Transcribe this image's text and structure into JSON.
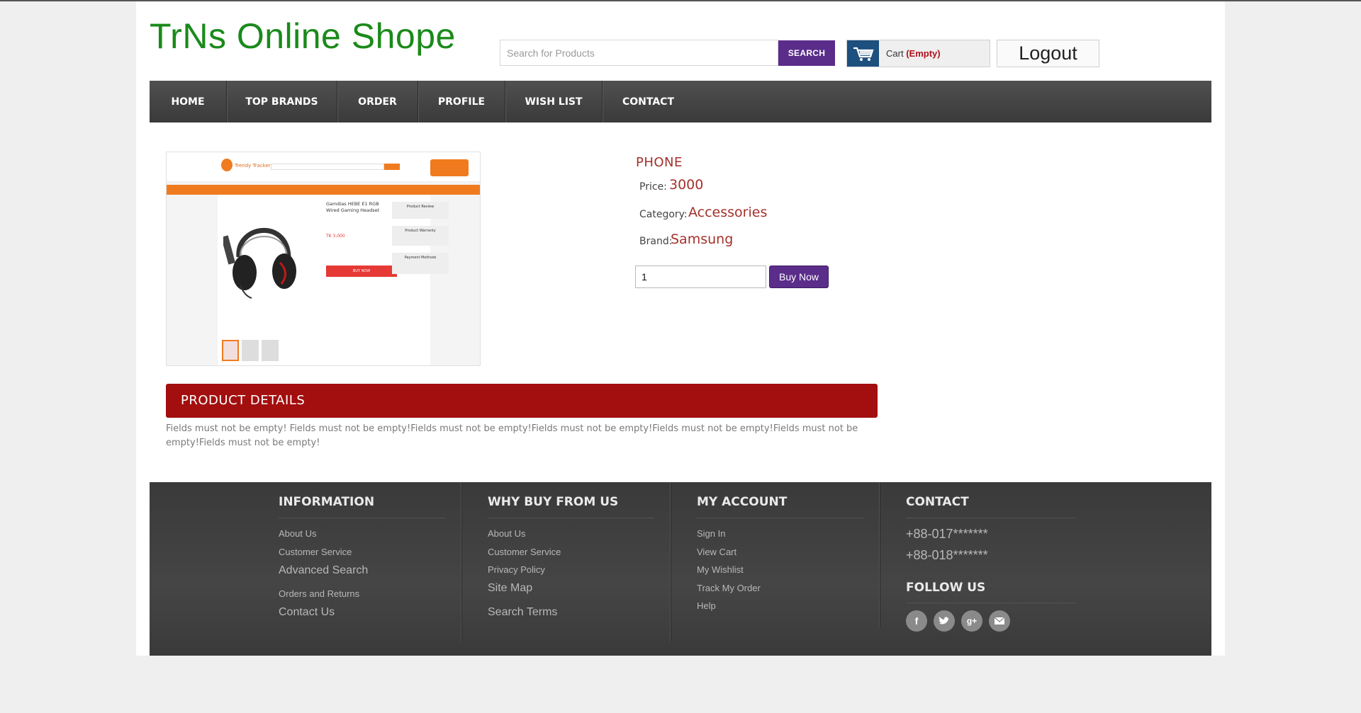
{
  "header": {
    "logo": "TrNs Online Shope",
    "search_placeholder": "Search for Products",
    "search_label": "SEARCH",
    "cart_label": "Cart",
    "cart_status": "(Empty)",
    "logout_label": "Logout"
  },
  "nav": {
    "items": [
      {
        "label": "HOME"
      },
      {
        "label": "TOP BRANDS"
      },
      {
        "label": "ORDER"
      },
      {
        "label": "PROFILE"
      },
      {
        "label": "WISH LIST"
      },
      {
        "label": "CONTACT"
      }
    ]
  },
  "product": {
    "name": "PHONE",
    "price_label": "Price:",
    "price": "3000",
    "category_label": "Category:",
    "category": "Accessories",
    "brand_label": "Brand:",
    "brand": "Samsung",
    "quantity": "1",
    "buy_label": "Buy Now",
    "details_heading": "PRODUCT DETAILS",
    "details_text": "Fields must not be empty! Fields must not be empty!Fields must not be empty!Fields must not be empty!Fields must not be empty!Fields must not be empty!Fields must not be empty!",
    "image": {
      "brand": "Trendy Tracker",
      "headline": "Gamdias HEBE E1 RGB Wired Gaming Headset",
      "price": "TK 3,000",
      "buy": "BUY NOW",
      "side_1": "Product Review",
      "side_2": "Product Warranty",
      "side_3": "Payment Methods"
    }
  },
  "footer": {
    "information": {
      "heading": "INFORMATION",
      "links": [
        "About Us",
        "Customer Service",
        "Advanced Search",
        "Orders and Returns",
        "Contact Us"
      ]
    },
    "why_buy": {
      "heading": "WHY BUY FROM US",
      "links": [
        "About Us",
        "Customer Service",
        "Privacy Policy",
        "Site Map",
        "Search Terms"
      ]
    },
    "my_account": {
      "heading": "MY ACCOUNT",
      "links": [
        "Sign In",
        "View Cart",
        "My Wishlist",
        "Track My Order",
        "Help"
      ]
    },
    "contact": {
      "heading": "CONTACT",
      "phones": [
        "+88-017*******",
        "+88-018*******"
      ],
      "follow_heading": "FOLLOW US",
      "social": [
        "facebook-icon",
        "twitter-icon",
        "google-plus-icon",
        "email-icon"
      ]
    }
  },
  "colors": {
    "logo": "#1a8a1a",
    "accent_purple": "#5a2d8a",
    "details_red": "#a30e0e",
    "value_red": "#a4312b",
    "cart_blue": "#1d4f7f"
  }
}
